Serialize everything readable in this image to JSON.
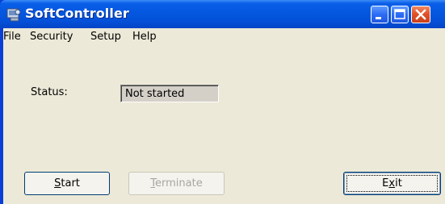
{
  "window": {
    "title": "SoftController",
    "accent": "#0457df",
    "close_color": "#e0532a",
    "app_icon": "controller-app-icon"
  },
  "menu": {
    "items": [
      "File",
      "Security",
      "Setup",
      "Help"
    ]
  },
  "status": {
    "label": "Status:",
    "value": "Not started"
  },
  "buttons": {
    "start": {
      "label": "Start",
      "mnemonic": "S",
      "enabled": true
    },
    "terminate": {
      "label": "Terminate",
      "mnemonic": "T",
      "enabled": false
    },
    "exit": {
      "label": "Exit",
      "mnemonic": "x",
      "enabled": true,
      "default": true
    }
  },
  "titlebar_buttons": [
    "minimize-icon",
    "maximize-icon",
    "close-icon"
  ]
}
